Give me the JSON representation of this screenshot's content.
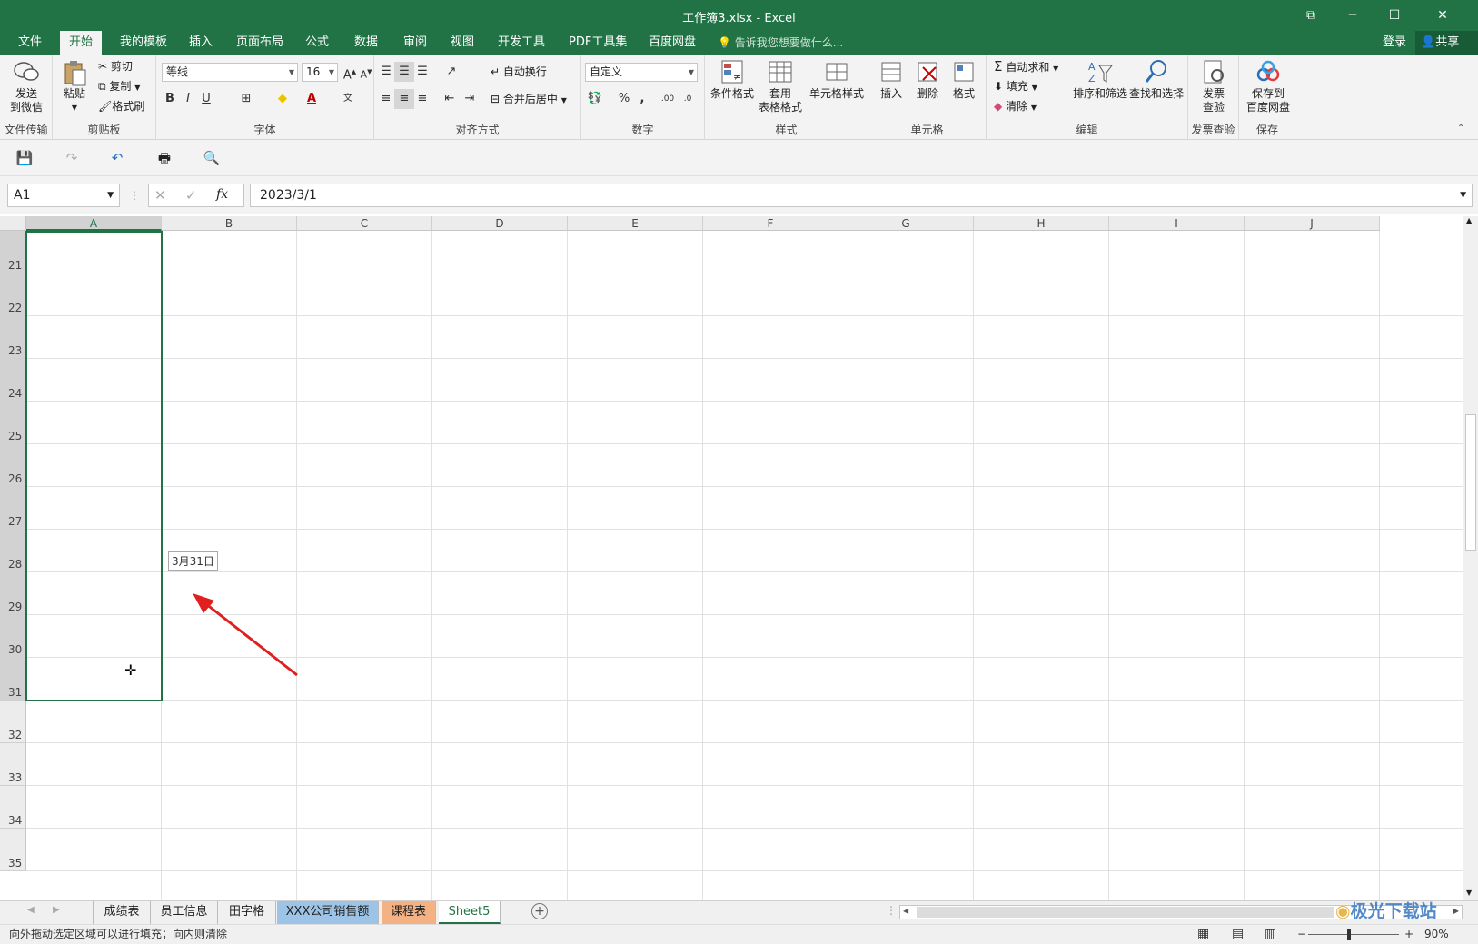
{
  "window": {
    "title": "工作簿3.xlsx - Excel"
  },
  "tabs": [
    "文件",
    "开始",
    "我的模板",
    "插入",
    "页面布局",
    "公式",
    "数据",
    "审阅",
    "视图",
    "开发工具",
    "PDF工具集",
    "百度网盘"
  ],
  "active_tab": "开始",
  "tellme": "告诉我您想要做什么...",
  "login": "登录",
  "share": "共享",
  "ribbon": {
    "send": {
      "label1": "发送",
      "label2": "到微信",
      "group": "文件传输"
    },
    "clipboard": {
      "paste": "粘贴",
      "cut": "剪切",
      "copy": "复制",
      "format_painter": "格式刷",
      "group": "剪贴板"
    },
    "font": {
      "name": "等线",
      "size": "16",
      "group": "字体",
      "bold": "B",
      "italic": "I",
      "underline": "U"
    },
    "align": {
      "wrap": "自动换行",
      "merge": "合并后居中",
      "group": "对齐方式"
    },
    "number": {
      "format": "自定义",
      "group": "数字"
    },
    "styles": {
      "cond": "条件格式",
      "table1": "套用",
      "table2": "表格格式",
      "cell_styles": "单元格样式",
      "group": "样式"
    },
    "cells": {
      "insert": "插入",
      "delete": "删除",
      "format": "格式",
      "group": "单元格"
    },
    "editing": {
      "autosum": "自动求和",
      "fill": "填充",
      "clear": "清除",
      "sort": "排序和筛选",
      "find": "查找和选择",
      "group": "编辑"
    },
    "invoice": {
      "label1": "发票",
      "label2": "查验",
      "group": "发票查验"
    },
    "save": {
      "label1": "保存到",
      "label2": "百度网盘",
      "group": "保存"
    }
  },
  "namebox": "A1",
  "formula": "2023/3/1",
  "columns": [
    "A",
    "B",
    "C",
    "D",
    "E",
    "F",
    "G",
    "H",
    "I",
    "J"
  ],
  "rows": [
    "21",
    "22",
    "23",
    "24",
    "25",
    "26",
    "27",
    "28",
    "29",
    "30",
    "31",
    "32",
    "33",
    "34",
    "35"
  ],
  "tooltip": "3月31日",
  "sheets": [
    "成绩表",
    "员工信息",
    "田字格",
    "XXX公司销售额",
    "课程表",
    "Sheet5"
  ],
  "active_sheet": "Sheet5",
  "status": "向外拖动选定区域可以进行填充；向内则清除",
  "zoom": "90%",
  "watermark": "极光下载站"
}
